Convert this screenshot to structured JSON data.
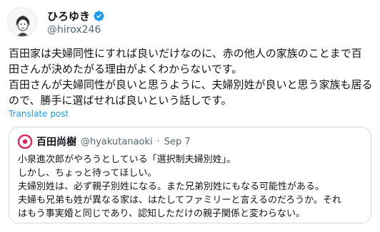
{
  "author": {
    "display_name": "ひろゆき",
    "handle": "@hirox246",
    "avatar_icon": "user-avatar-icon",
    "verified_icon": "verified-badge-icon",
    "verified_color": "#1d9bf0"
  },
  "tweet": {
    "lines": [
      "百田家は夫婦同性にすれば良いだけなのに、赤の他人の家族のことまで百",
      "田さんが決めたがる理由がよくわからないです。",
      "百田さんが夫婦同性が良いと思うように、夫婦別姓が良いと思う家族も居る",
      "ので、勝手に選ばせれば良いという話しです。"
    ],
    "translate_label": "Translate post"
  },
  "quote": {
    "display_name": "百田尚樹",
    "handle": "@hyakutanaoki",
    "separator": "·",
    "date": "Sep 7",
    "avatar_icon": "quoted-user-avatar-icon",
    "avatar_color": "#e0245e",
    "lines": [
      "小泉進次郎がやろうとしている「選択制夫婦別姓」。",
      "しかし、ちょっと待ってほしい。",
      "夫婦別姓は、必ず親子別姓になる。また兄弟別姓にもなる可能性がある。",
      "夫婦も兄弟も姓が異なる家は、はたしてファミリーと言えるのだろうか。それ",
      "はもう事実婚と同じであり、認知しただけの親子関係と変わらない。"
    ]
  }
}
